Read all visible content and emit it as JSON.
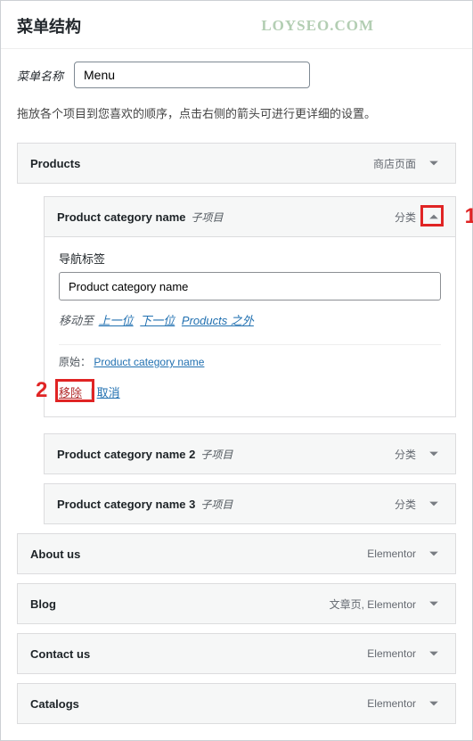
{
  "watermark": "LOYSEO.COM",
  "header": {
    "title": "菜单结构"
  },
  "menuName": {
    "label": "菜单名称",
    "value": "Menu"
  },
  "description": "拖放各个项目到您喜欢的顺序，点击右侧的箭头可进行更详细的设置。",
  "annotations": {
    "one": "1",
    "two": "2"
  },
  "items": [
    {
      "title": "Products",
      "type": "商店页面",
      "sub": ""
    },
    {
      "title": "Product category name",
      "type": "分类",
      "sub": "子项目",
      "expanded": true
    },
    {
      "title": "Product category name 2",
      "type": "分类",
      "sub": "子项目"
    },
    {
      "title": "Product category name 3",
      "type": "分类",
      "sub": "子项目"
    },
    {
      "title": "About us",
      "type": "Elementor",
      "sub": ""
    },
    {
      "title": "Blog",
      "type": "文章页, Elementor",
      "sub": ""
    },
    {
      "title": "Contact us",
      "type": "Elementor",
      "sub": ""
    },
    {
      "title": "Catalogs",
      "type": "Elementor",
      "sub": ""
    }
  ],
  "settings": {
    "navLabel": "导航标签",
    "navValue": "Product category name",
    "moveLabel": "移动至",
    "moveUp": "上一位",
    "moveDown": "下一位",
    "moveOut": "Products 之外",
    "originalLabel": "原始：",
    "originalLink": "Product category name",
    "remove": "移除",
    "cancel": "取消"
  }
}
